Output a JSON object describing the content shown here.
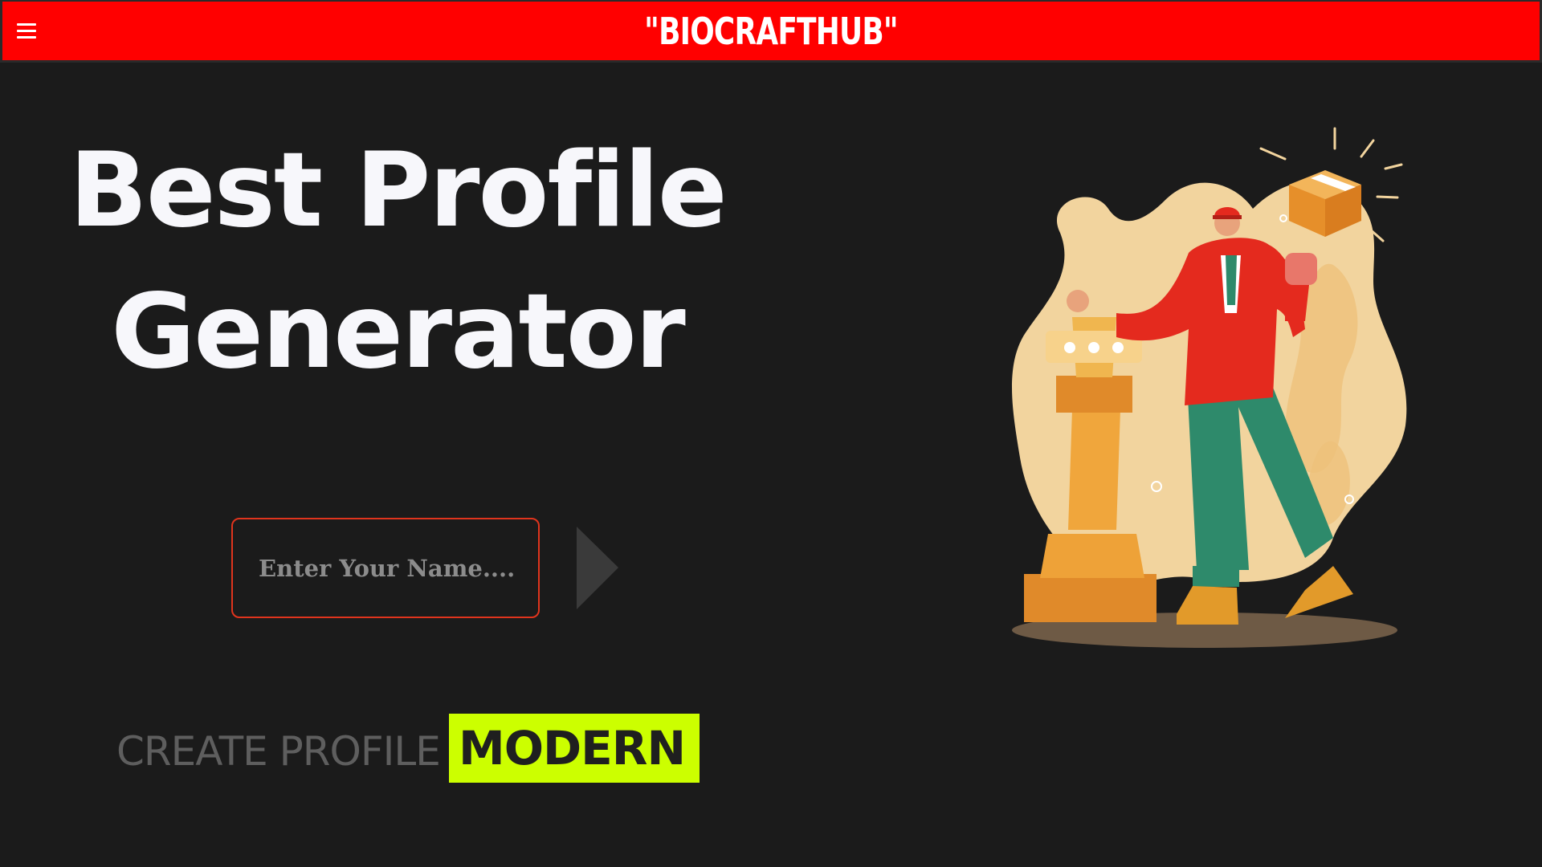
{
  "header": {
    "brand": "\"BIOCRAFTHUB\"",
    "menu_icon": "hamburger-menu-icon"
  },
  "hero": {
    "title_line1": "Best Profile",
    "title_line2": "Generator"
  },
  "form": {
    "name_placeholder": "Enter Your Name....",
    "submit_icon": "play-arrow-icon"
  },
  "cta": {
    "static_text": "CREATE PROFILE",
    "highlight_text": "MODERN"
  },
  "illustration": {
    "icon": "businessman-chess-illustration"
  },
  "colors": {
    "topbar": "#ff0000",
    "background": "#1b1b1b",
    "highlight": "#ccff00",
    "input_border": "#e0341d"
  }
}
